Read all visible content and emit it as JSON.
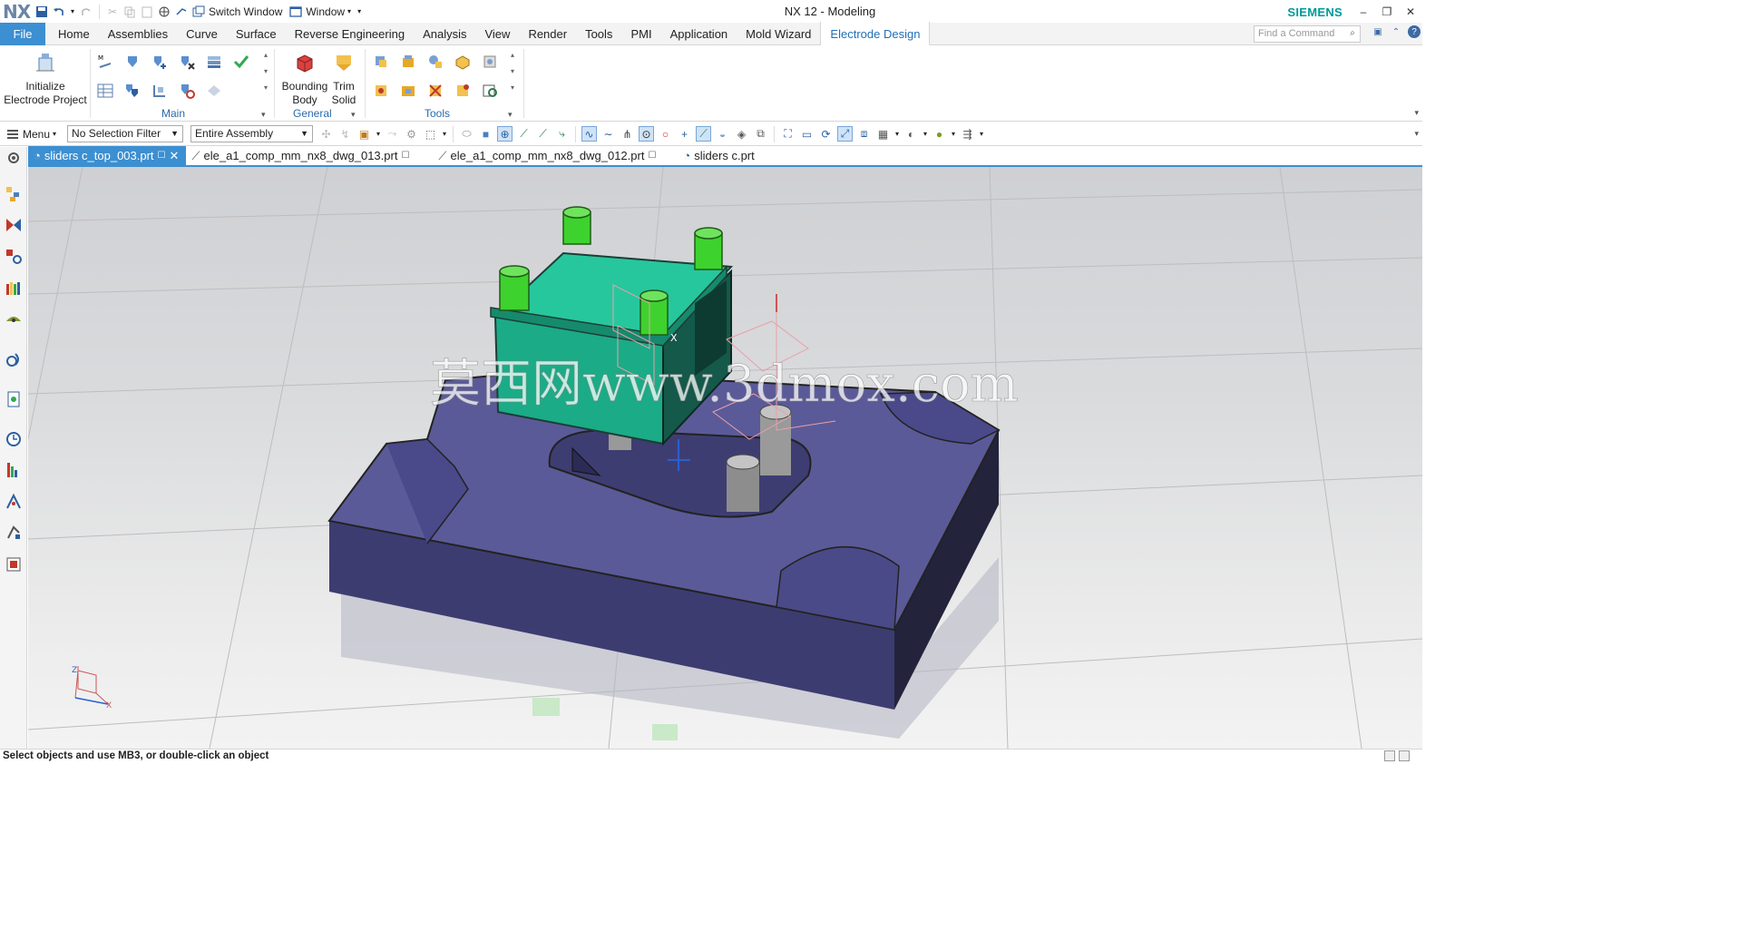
{
  "app": {
    "logo": "NX",
    "title": "NX 12 - Modeling",
    "brand": "SIEMENS",
    "switch_window": "Switch Window",
    "window_menu": "Window"
  },
  "menu_tabs": [
    "File",
    "Home",
    "Assemblies",
    "Curve",
    "Surface",
    "Reverse Engineering",
    "Analysis",
    "View",
    "Render",
    "Tools",
    "PMI",
    "Application",
    "Mold Wizard",
    "Electrode Design"
  ],
  "active_tab": "Electrode Design",
  "search": {
    "placeholder": "Find a Command"
  },
  "ribbon": {
    "initialize": "Initialize\nElectrode Project",
    "bounding_body": "Bounding\nBody",
    "trim_solid": "Trim\nSolid",
    "group_main": "Main",
    "group_general": "General",
    "group_tools": "Tools"
  },
  "selection_bar": {
    "menu": "Menu",
    "filter": "No Selection Filter",
    "scope": "Entire Assembly"
  },
  "doc_tabs": [
    {
      "label": "sliders c_top_003.prt",
      "active": true
    },
    {
      "label": "ele_a1_comp_mm_nx8_dwg_013.prt",
      "active": false
    },
    {
      "label": "ele_a1_comp_mm_nx8_dwg_012.prt",
      "active": false
    },
    {
      "label": "sliders c.prt",
      "active": false
    }
  ],
  "watermark": "莫西网www.3dmox.com",
  "triad": {
    "z": "Z",
    "x": "X",
    "y": "Y"
  },
  "status": "Select objects and use MB3, or double-click an object",
  "colors": {
    "file_tab": "#3c8fd1",
    "active_tab_text": "#1f6fb7",
    "brand": "#009999",
    "base_plate": "#5b5a98",
    "electrode": "#1bab87",
    "bosses": "#3ed22e"
  }
}
